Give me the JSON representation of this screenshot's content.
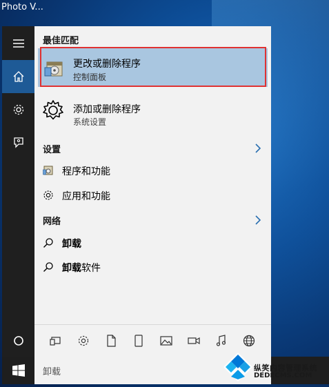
{
  "desktop": {
    "window_label": "Photo V..."
  },
  "rail": {
    "items": [
      {
        "icon": "hamburger-icon"
      },
      {
        "icon": "home-icon"
      },
      {
        "icon": "gear-icon"
      },
      {
        "icon": "feedback-icon"
      },
      {
        "icon": "power-icon"
      }
    ]
  },
  "best_match": {
    "header": "最佳匹配",
    "title": "更改或删除程序",
    "subtitle": "控制面板"
  },
  "second_result": {
    "title": "添加或删除程序",
    "subtitle": "系统设置"
  },
  "settings": {
    "header": "设置",
    "items": [
      {
        "label": "程序和功能",
        "icon": "programs-icon"
      },
      {
        "label": "应用和功能",
        "icon": "gear-icon"
      }
    ]
  },
  "web": {
    "header": "网络",
    "items": [
      {
        "label": "卸载",
        "icon": "search-icon"
      },
      {
        "label_bold": "卸载",
        "label_rest": "软件",
        "icon": "search-icon"
      }
    ]
  },
  "filter_bar": {
    "icons": [
      "apps-icon",
      "gear-icon",
      "document-icon",
      "tablet-icon",
      "photo-icon",
      "video-icon",
      "music-icon",
      "globe-icon"
    ]
  },
  "taskbar": {
    "search_text": "卸载"
  },
  "watermark": {
    "line1": "纵笑内容管理系统",
    "line2": "DEDECMS.COM"
  },
  "colors": {
    "accent": "#1e5a96",
    "highlight": "#a9c6e0",
    "red_box": "#e03131"
  }
}
